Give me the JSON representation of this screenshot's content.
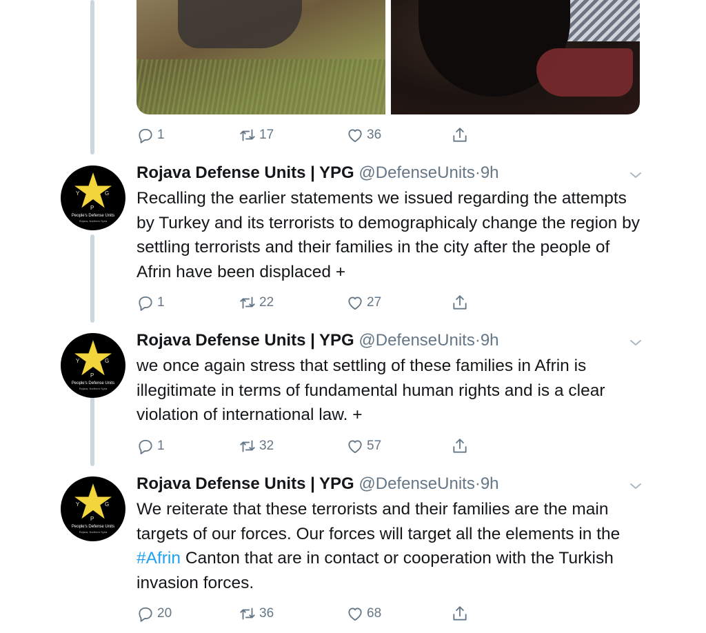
{
  "top_tweet": {
    "media": {
      "images": [
        "image-left",
        "image-right"
      ]
    },
    "actions": {
      "reply": "1",
      "retweet": "17",
      "like": "36"
    }
  },
  "tweets": [
    {
      "name": "Rojava Defense Units | YPG",
      "handle": "@DefenseUnits",
      "dot": "·",
      "time": "9h",
      "text": "Recalling the earlier statements we issued regarding the attempts by Turkey and its terrorists to demographicaly change the region by settling terrorists and their families in the city after the people of Afrin have been displaced +",
      "actions": {
        "reply": "1",
        "retweet": "22",
        "like": "27"
      }
    },
    {
      "name": "Rojava Defense Units | YPG",
      "handle": "@DefenseUnits",
      "dot": "·",
      "time": "9h",
      "text": "we once again stress that settling of these families in Afrin is illegitimate in terms of fundamental human rights and is a clear violation of international law. +",
      "actions": {
        "reply": "1",
        "retweet": "32",
        "like": "57"
      }
    },
    {
      "name": "Rojava Defense Units | YPG",
      "handle": "@DefenseUnits",
      "dot": "·",
      "time": "9h",
      "text_before": "We reiterate that these terrorists and their families are the main targets of our forces. Our forces will target all the elements in the ",
      "hashtag": "#Afrin",
      "text_after": " Canton that are in contact or cooperation with the Turkish invasion forces.",
      "actions": {
        "reply": "20",
        "retweet": "36",
        "like": "68"
      }
    }
  ],
  "avatar": {
    "letters": {
      "y": "Y",
      "g": "G",
      "p": "P"
    },
    "name": "People's Defense Units",
    "sub": "Rojava, Northern Syria",
    "star_color": "#f2d53c"
  },
  "icons": {
    "reply": "reply-icon",
    "retweet": "retweet-icon",
    "like": "heart-icon",
    "share": "share-icon",
    "more": "chevron-down-icon"
  },
  "colors": {
    "text": "#14171a",
    "secondary": "#657786",
    "link": "#1da1f2",
    "thread_line": "#ccd6dd"
  }
}
